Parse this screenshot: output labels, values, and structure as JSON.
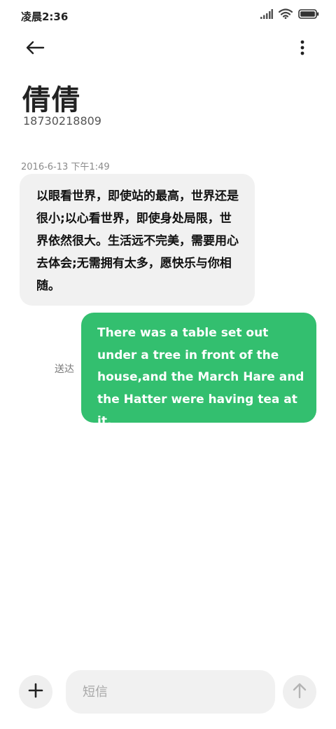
{
  "status_bar": {
    "time": "凌晨2:36",
    "icons": [
      "signal-icon",
      "wifi-icon",
      "battery-icon"
    ]
  },
  "header": {
    "back_icon": "back-arrow-icon",
    "more_icon": "more-vertical-icon",
    "contact_name": "倩倩",
    "contact_number": "18730218809"
  },
  "conversation": {
    "timestamp": "2016-6-13 下午1:49",
    "received_message": "以眼看世界，即使站的最高，世界还是很小;以心看世界，即使身处局限，世界依然很大。生活远不完美，需要用心去体会;无需拥有太多，愿快乐与你相随。",
    "sent_message": "There was a table set out under a tree in front of the house,and the March Hare and the Hatter were having tea at it.",
    "sent_status": "送达"
  },
  "composer": {
    "add_icon": "plus-icon",
    "placeholder": "短信",
    "value": "",
    "send_icon": "send-arrow-icon"
  },
  "colors": {
    "sent_bubble": "#33bf6f",
    "received_bubble": "#f1f1f1",
    "background": "#ffffff"
  }
}
